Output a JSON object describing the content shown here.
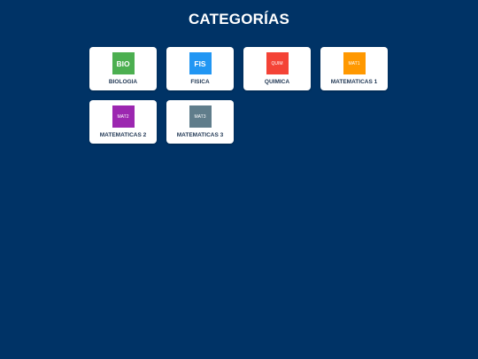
{
  "page": {
    "title": "CATEGORÍAS"
  },
  "categories": [
    {
      "label": "BIOLOGIA",
      "icon_text": "BIO",
      "color": "#4caf50"
    },
    {
      "label": "FISICA",
      "icon_text": "FIS",
      "color": "#2196f3"
    },
    {
      "label": "QUIMICA",
      "icon_text": "QUIM",
      "color": "#f44336"
    },
    {
      "label": "MATEMATICAS 1",
      "icon_text": "MAT1",
      "color": "#ff9800"
    },
    {
      "label": "MATEMATICAS 2",
      "icon_text": "MAT2",
      "color": "#9c27b0"
    },
    {
      "label": "MATEMATICAS 3",
      "icon_text": "MAT3",
      "color": "#607d8b"
    }
  ],
  "colors": {
    "background": "#003366",
    "card": "#ffffff",
    "label_text": "#1f3653"
  }
}
